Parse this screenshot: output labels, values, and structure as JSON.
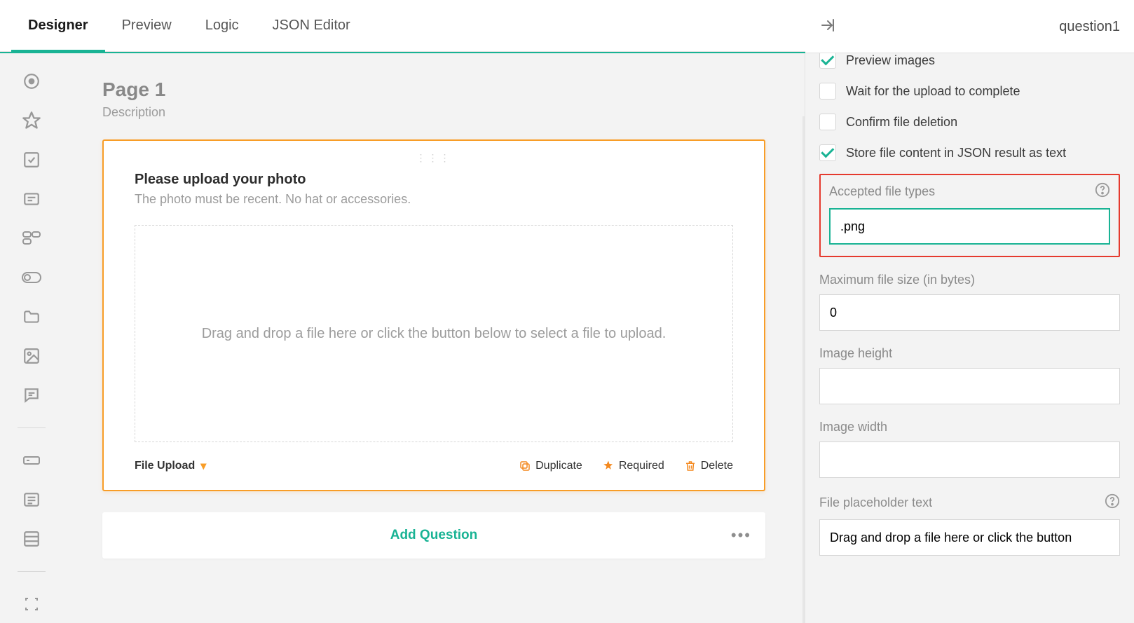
{
  "tabs": {
    "designer": "Designer",
    "preview": "Preview",
    "logic": "Logic",
    "json_editor": "JSON Editor"
  },
  "props_header": {
    "title": "question1"
  },
  "page": {
    "title": "Page 1",
    "description": "Description"
  },
  "question": {
    "title": "Please upload your photo",
    "description": "The photo must be recent. No hat or accessories.",
    "dropzone_text": "Drag and drop a file here or click the button below to select a file to upload.",
    "type_label": "File Upload",
    "actions": {
      "duplicate": "Duplicate",
      "required": "Required",
      "delete": "Delete"
    }
  },
  "add_question_label": "Add Question",
  "props": {
    "checks": {
      "preview_images": {
        "label": "Preview images",
        "checked": true
      },
      "wait_upload": {
        "label": "Wait for the upload to complete",
        "checked": false
      },
      "confirm_delete": {
        "label": "Confirm file deletion",
        "checked": false
      },
      "store_json": {
        "label": "Store file content in JSON result as text",
        "checked": true
      }
    },
    "accepted_file_types": {
      "label": "Accepted file types",
      "value": ".png"
    },
    "max_file_size": {
      "label": "Maximum file size (in bytes)",
      "value": "0"
    },
    "image_height": {
      "label": "Image height",
      "value": ""
    },
    "image_width": {
      "label": "Image width",
      "value": ""
    },
    "placeholder_text": {
      "label": "File placeholder text",
      "value": "Drag and drop a file here or click the button"
    }
  }
}
